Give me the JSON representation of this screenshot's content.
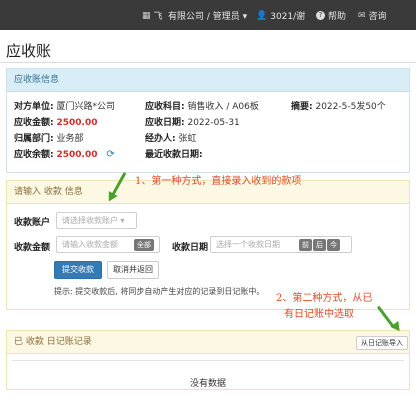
{
  "topbar": {
    "items": [
      {
        "icon": "grid-icon",
        "glyph": "▦",
        "label": "飞"
      },
      {
        "icon": "user-icon",
        "glyph": "",
        "label": "有限公司 / 管理员 ▾"
      },
      {
        "icon": "person-icon",
        "glyph": "👤",
        "label": "3021/谢"
      },
      {
        "icon": "help-icon",
        "glyph": "?",
        "label": "帮助"
      },
      {
        "icon": "message-icon",
        "glyph": "✉",
        "label": "咨询"
      }
    ]
  },
  "page": {
    "title": "应收账"
  },
  "info": {
    "header": "应收账信息",
    "counterparty_label": "对方单位:",
    "counterparty_value": "厦门兴路*公司",
    "account_label": "应收科目:",
    "account_value": "销售收入 / A06板",
    "summary_label": "摘要:",
    "summary_value": "2022-5-5发50个",
    "receivable_label": "应收金额:",
    "receivable_value": "2500.00",
    "due_date_label": "应收日期:",
    "due_date_value": "2022-05-31",
    "dept_label": "归属部门:",
    "dept_value": "业务部",
    "handler_label": "经办人:",
    "handler_value": "张虹",
    "balance_label": "应收余额:",
    "balance_value": "2500.00",
    "last_date_label": "最近收款日期:",
    "last_date_value": ""
  },
  "entry": {
    "header": "请输入 收款 信息",
    "account_label": "收款账户",
    "account_placeholder": "请选择收款账户 ▾",
    "amount_label": "收款金额",
    "amount_placeholder": "请输入收款金额",
    "amount_pill": "全部",
    "date_label": "收款日期",
    "date_placeholder": "选择一个收款日期",
    "date_pills": [
      "前",
      "后",
      "今"
    ],
    "submit_label": "提交收款",
    "cancel_label": "取消并返回",
    "hint": "提示: 提交收款后, 将同步自动产生对应的记录到日记账中。"
  },
  "journal": {
    "header": "已 收款 日记账记录",
    "import_label": "从日记账导入",
    "empty_text": "没有数据"
  },
  "annotations": {
    "first": "1、第一种方式，直接录入收到的款项",
    "second_line1": "2、第二种方式，从已",
    "second_line2": "有日记账中选取"
  },
  "colors": {
    "topbar": "#3a3a3a",
    "primary": "#337ab7",
    "red_amount": "#c9302c",
    "annotation": "#e04a2a",
    "arrow": "#4aa02c"
  }
}
